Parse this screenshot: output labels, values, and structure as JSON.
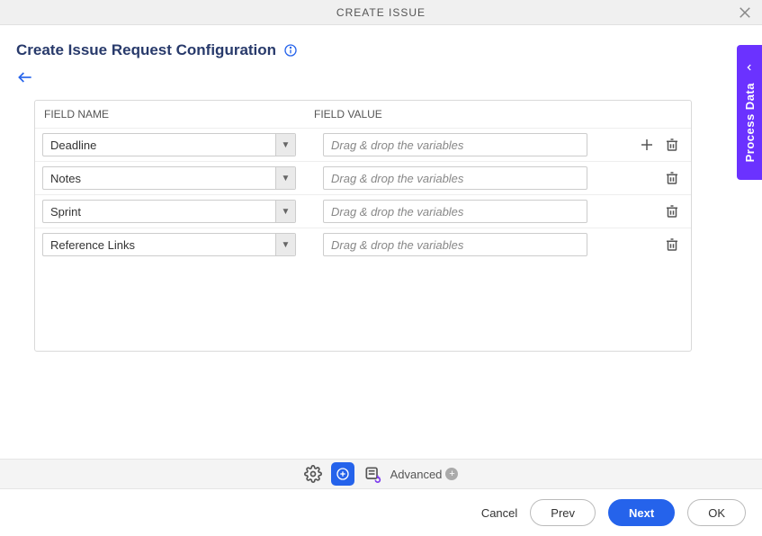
{
  "header": {
    "title": "CREATE ISSUE"
  },
  "page": {
    "title": "Create Issue Request Configuration"
  },
  "table": {
    "header_name": "FIELD NAME",
    "header_value": "FIELD VALUE",
    "value_placeholder": "Drag & drop the variables",
    "rows": [
      {
        "field": "Deadline",
        "show_add": true
      },
      {
        "field": "Notes",
        "show_add": false
      },
      {
        "field": "Sprint",
        "show_add": false
      },
      {
        "field": "Reference Links",
        "show_add": false
      }
    ]
  },
  "side_tab": {
    "label": "Process Data"
  },
  "toolbar": {
    "advanced": "Advanced"
  },
  "footer": {
    "cancel": "Cancel",
    "prev": "Prev",
    "next": "Next",
    "ok": "OK"
  }
}
